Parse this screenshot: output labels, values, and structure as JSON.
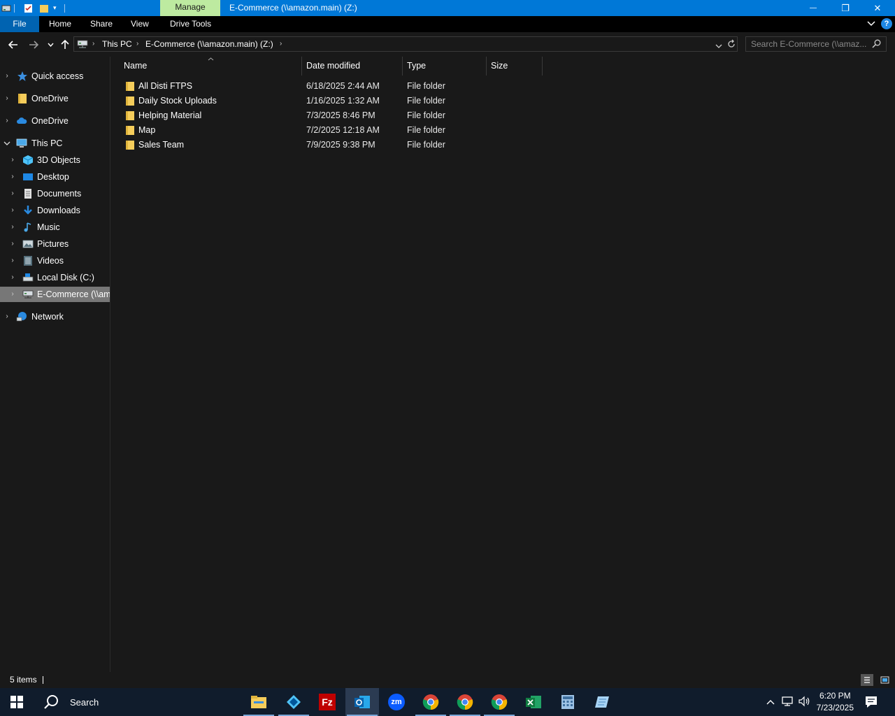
{
  "window": {
    "manage_tab": "Manage",
    "title": "E-Commerce (\\\\amazon.main) (Z:)",
    "minimize_glyph": "—",
    "maximize_glyph": "❐",
    "close_glyph": "✕"
  },
  "ribbon": {
    "tabs": [
      "File",
      "Home",
      "Share",
      "View",
      "Drive Tools"
    ],
    "collapse_glyph": "⌄",
    "help_glyph": "?"
  },
  "address": {
    "crumbs": [
      "This PC",
      "E-Commerce (\\\\amazon.main) (Z:)"
    ],
    "separator": "›"
  },
  "search": {
    "placeholder": "Search E-Commerce (\\\\amaz..."
  },
  "navpane": {
    "items": [
      {
        "label": "Quick access",
        "icon": "star-icon"
      },
      {
        "label": "OneDrive",
        "icon": "folder-icon"
      },
      {
        "label": "OneDrive",
        "icon": "cloud-icon"
      },
      {
        "label": "This PC",
        "icon": "computer-icon"
      },
      {
        "label": "3D Objects",
        "icon": "cube-icon"
      },
      {
        "label": "Desktop",
        "icon": "desktop-icon"
      },
      {
        "label": "Documents",
        "icon": "document-icon"
      },
      {
        "label": "Downloads",
        "icon": "download-icon"
      },
      {
        "label": "Music",
        "icon": "music-icon"
      },
      {
        "label": "Pictures",
        "icon": "pictures-icon"
      },
      {
        "label": "Videos",
        "icon": "videos-icon"
      },
      {
        "label": "Local Disk (C:)",
        "icon": "disk-icon"
      },
      {
        "label": "E-Commerce (\\\\amazon.main) (Z:)",
        "icon": "network-drive-icon"
      },
      {
        "label": "Network",
        "icon": "network-icon"
      }
    ]
  },
  "columns": {
    "name": "Name",
    "date": "Date modified",
    "type": "Type",
    "size": "Size"
  },
  "files": [
    {
      "name": "All Disti FTPS",
      "date": "6/18/2025 2:44 AM",
      "type": "File folder",
      "size": ""
    },
    {
      "name": "Daily Stock Uploads",
      "date": "1/16/2025 1:32 AM",
      "type": "File folder",
      "size": ""
    },
    {
      "name": "Helping Material",
      "date": "7/3/2025 8:46 PM",
      "type": "File folder",
      "size": ""
    },
    {
      "name": "Map",
      "date": "7/2/2025 12:18 AM",
      "type": "File folder",
      "size": ""
    },
    {
      "name": "Sales Team",
      "date": "7/9/2025 9:38 PM",
      "type": "File folder",
      "size": ""
    }
  ],
  "status": {
    "item_count": "5 items"
  },
  "taskbar": {
    "search_label": "Search",
    "apps": [
      "file-explorer",
      "app-diamond",
      "filezilla",
      "outlook",
      "zoom",
      "chrome",
      "chrome-profile-2",
      "chrome-profile-3",
      "excel",
      "calculator",
      "notes"
    ],
    "time": "6:20 PM",
    "date": "7/23/2025"
  },
  "colors": {
    "titlebar": "#0078d7",
    "manage": "#bdeaa0",
    "file_tab": "#0063b1",
    "folder": "#f5cd5b",
    "selected": "#777777",
    "taskbar": "#101c2c"
  }
}
